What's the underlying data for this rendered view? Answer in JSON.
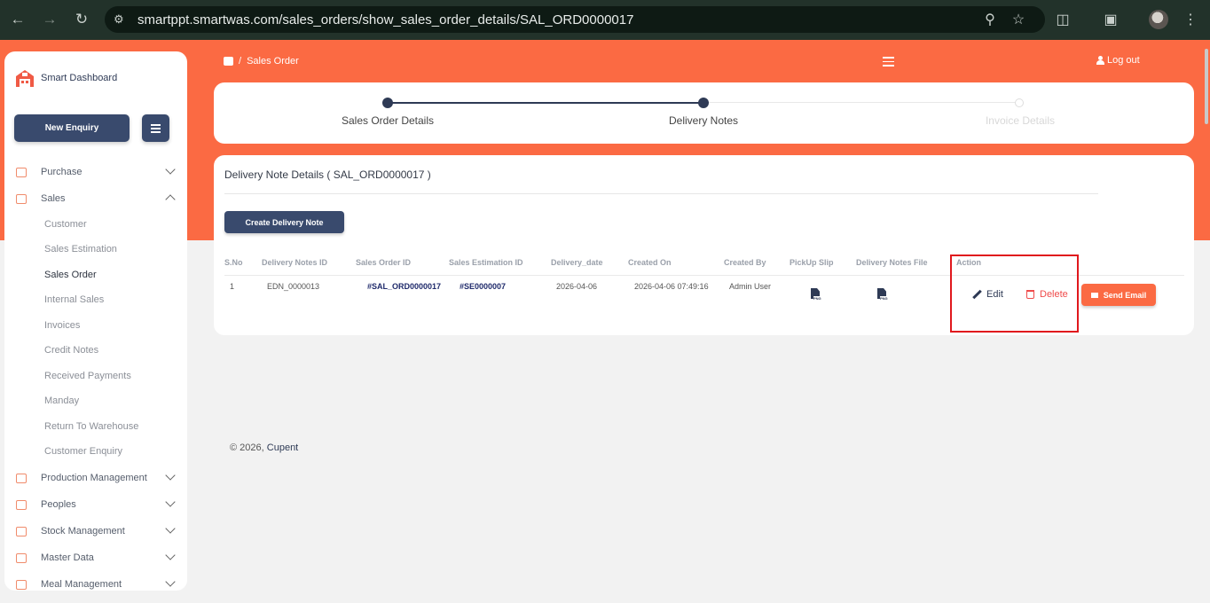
{
  "browser": {
    "url": "smartppt.smartwas.com/sales_orders/show_sales_order_details/SAL_ORD0000017"
  },
  "sidebar": {
    "brand": "Smart Dashboard",
    "new_enquiry": "New Enquiry",
    "items": [
      {
        "label": "Purchase",
        "icon": "cart-icon"
      },
      {
        "label": "Sales",
        "icon": "clipboard-icon"
      },
      {
        "label": "Production Management",
        "icon": "factory-icon"
      },
      {
        "label": "Peoples",
        "icon": "people-icon"
      },
      {
        "label": "Stock Management",
        "icon": "box-icon"
      },
      {
        "label": "Master Data",
        "icon": "database-icon"
      },
      {
        "label": "Meal Management",
        "icon": "meal-icon"
      }
    ],
    "sales_sub": [
      "Customer",
      "Sales Estimation",
      "Sales Order",
      "Internal Sales",
      "Invoices",
      "Credit Notes",
      "Received Payments",
      "Manday",
      "Return To Warehouse",
      "Customer Enquiry"
    ],
    "active_sub": "Sales Order"
  },
  "header": {
    "separator": "/",
    "breadcrumb": "Sales Order",
    "logout": "Log out"
  },
  "stepper": {
    "steps": [
      "Sales Order Details",
      "Delivery Notes",
      "Invoice Details"
    ],
    "completed": 2
  },
  "card": {
    "title": "Delivery Note Details ( SAL_ORD0000017 )",
    "create_button": "Create Delivery Note",
    "columns": [
      "S.No",
      "Delivery Notes ID",
      "Sales Order ID",
      "Sales Estimation ID",
      "Delivery_date",
      "Created On",
      "Created By",
      "PickUp Slip",
      "Delivery Notes File",
      "Action"
    ],
    "row": {
      "sno": "1",
      "delivery_note_id": "EDN_0000013",
      "sales_order_id": "#SAL_ORD0000017",
      "sales_estimation_id": "#SE0000007",
      "delivery_date": "2026-04-06",
      "created_on": "2026-04-06 07:49:16",
      "created_by": "Admin User",
      "file_type": "PNG"
    },
    "actions": {
      "edit": "Edit",
      "delete": "Delete",
      "send_email": "Send Email"
    }
  },
  "footer": {
    "text": "© 2026,",
    "link": "Cupent"
  },
  "colors": {
    "accent": "#fb6a43",
    "primary": "#394a6d",
    "danger": "#ef4b4b",
    "highlight": "#e0181d"
  }
}
